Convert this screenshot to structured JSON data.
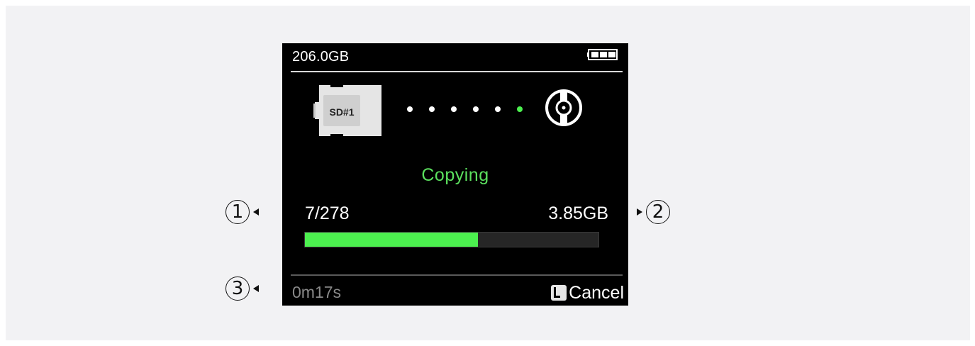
{
  "device": {
    "capacity": "206.0GB",
    "sd_card_label": "SD#1",
    "status": "Copying",
    "file_count": "7/278",
    "copied_size": "3.85GB",
    "elapsed_time": "0m17s",
    "cancel_label": "Cancel",
    "progress_fraction": 0.59,
    "battery_level_bars": 3,
    "transfer_dots": {
      "total": 6,
      "active_index": 5
    }
  },
  "callouts": {
    "one": "1",
    "two": "2",
    "three": "3"
  },
  "colors": {
    "accent_green": "#4cf04f",
    "status_green": "#5be05e",
    "progress_track": "#262626",
    "panel_bg": "#f2f2f4"
  },
  "icons": {
    "battery": "battery-icon",
    "sd_card": "sd-card-icon",
    "drive": "drive-icon",
    "cancel_button_glyph": "l-button-icon"
  }
}
